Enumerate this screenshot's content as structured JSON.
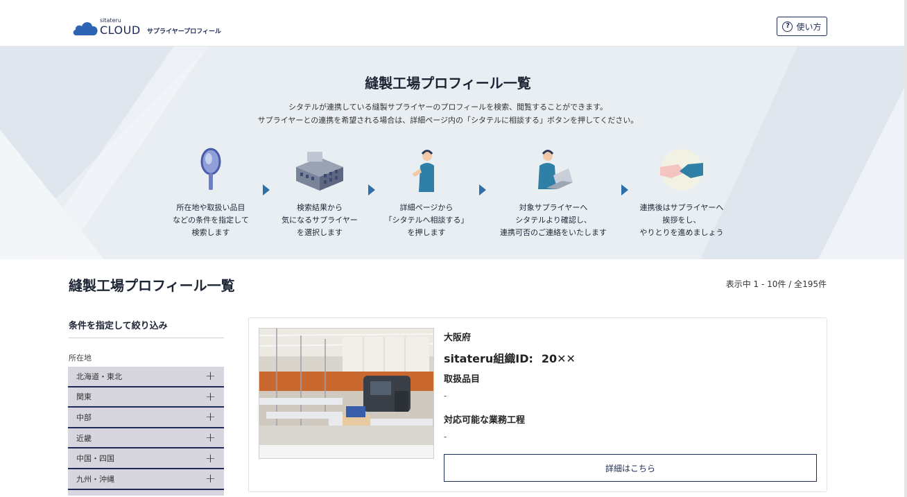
{
  "header": {
    "logo_small": "sitateru",
    "logo_big": "CLOUD",
    "logo_sub": "サプライヤープロフィール",
    "help_label": "使い方",
    "help_icon": "question-circle-icon"
  },
  "hero": {
    "title": "縫製工場プロフィール一覧",
    "desc_line1": "シタテルが連携している縫製サプライヤーのプロフィールを検索、閲覧することができます。",
    "desc_line2": "サプライヤーとの連携を希望される場合は、詳細ページ内の「シタテルに相談する」ボタンを押してください。",
    "steps": [
      {
        "icon": "magnifier-icon",
        "text": "所在地や取扱い品目\nなどの条件を指定して\n検索します"
      },
      {
        "icon": "factory-building-icon",
        "text": "検索結果から\n気になるサプライヤー\nを選択します"
      },
      {
        "icon": "operator-person-icon",
        "text": "詳細ページから\n「シタテルへ相談する」\nを押します"
      },
      {
        "icon": "operator-laptop-icon",
        "text": "対象サプライヤーへ\nシタテルより確認し、\n連携可否のご連絡をいたします"
      },
      {
        "icon": "handshake-icon",
        "text": "連携後はサプライヤーへ\n挨拶をし、\nやりとりを進めましょう"
      }
    ]
  },
  "main": {
    "title": "縫製工場プロフィール一覧",
    "count_text": "表示中 1 - 10件 / 全195件"
  },
  "filter": {
    "title": "条件を指定して絞り込み",
    "location_label": "所在地",
    "regions": [
      {
        "label": "北海道・東北"
      },
      {
        "label": "関東"
      },
      {
        "label": "中部"
      },
      {
        "label": "近畿"
      },
      {
        "label": "中国・四国"
      },
      {
        "label": "九州・沖縄"
      }
    ]
  },
  "card": {
    "prefecture": "大阪府",
    "id_label": "sitateru組織ID:",
    "id_value": "20✕✕",
    "items_heading": "取扱品目",
    "items_value": "-",
    "process_heading": "対応可能な業務工程",
    "process_value": "-",
    "detail_button": "詳細はこちら",
    "photo_alt": "sewing-factory-photo"
  },
  "colors": {
    "navy": "#1d2a57",
    "hero_bg": "#e9eef3",
    "filter_item_bg": "#d7d6df",
    "arrow": "#2f6fa8"
  }
}
